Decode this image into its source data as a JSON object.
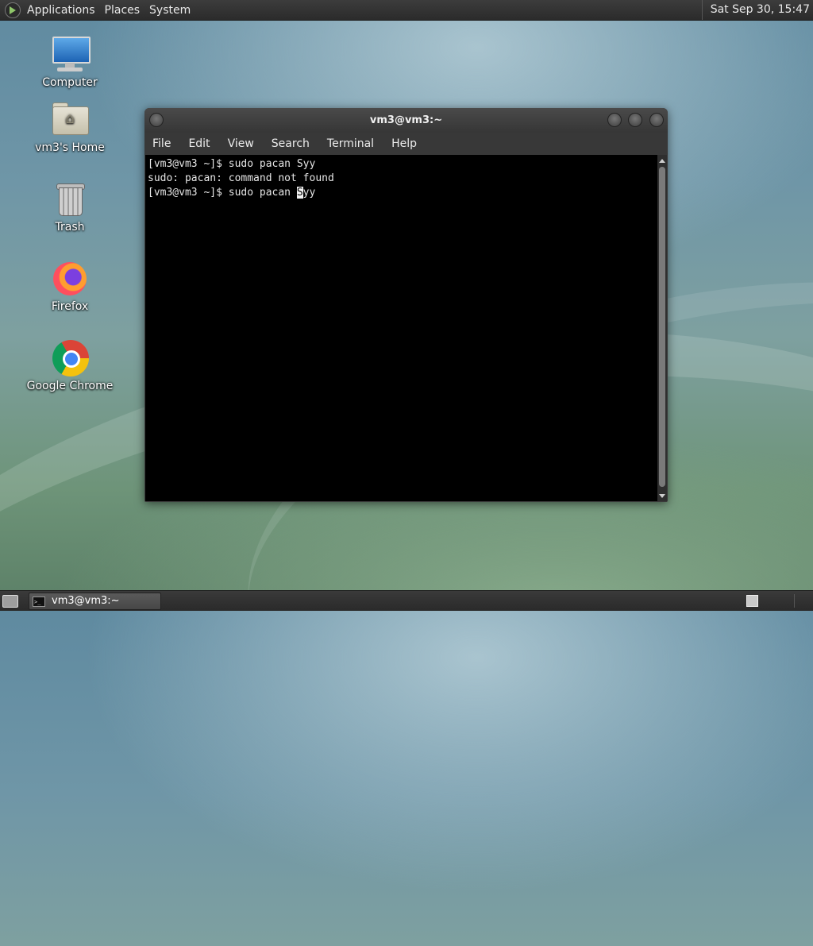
{
  "top_panel": {
    "menus": [
      "Applications",
      "Places",
      "System"
    ],
    "clock": "Sat Sep 30, 15:47"
  },
  "desktop": {
    "icons": [
      {
        "label": "Computer",
        "icon": "computer-icon"
      },
      {
        "label": "vm3's Home",
        "icon": "home-folder-icon"
      },
      {
        "label": "Trash",
        "icon": "trash-icon"
      },
      {
        "label": "Firefox",
        "icon": "firefox-icon"
      },
      {
        "label": "Google Chrome",
        "icon": "chrome-icon"
      }
    ]
  },
  "terminal": {
    "title": "vm3@vm3:~",
    "menu": [
      "File",
      "Edit",
      "View",
      "Search",
      "Terminal",
      "Help"
    ],
    "lines": [
      "[vm3@vm3 ~]$ sudo pacan Syy",
      "sudo: pacan: command not found"
    ],
    "prompt_before_cursor": "[vm3@vm3 ~]$ sudo pacan ",
    "cursor_char": "S",
    "prompt_after_cursor": "yy"
  },
  "bottom_panel": {
    "task_label": "vm3@vm3:~"
  }
}
